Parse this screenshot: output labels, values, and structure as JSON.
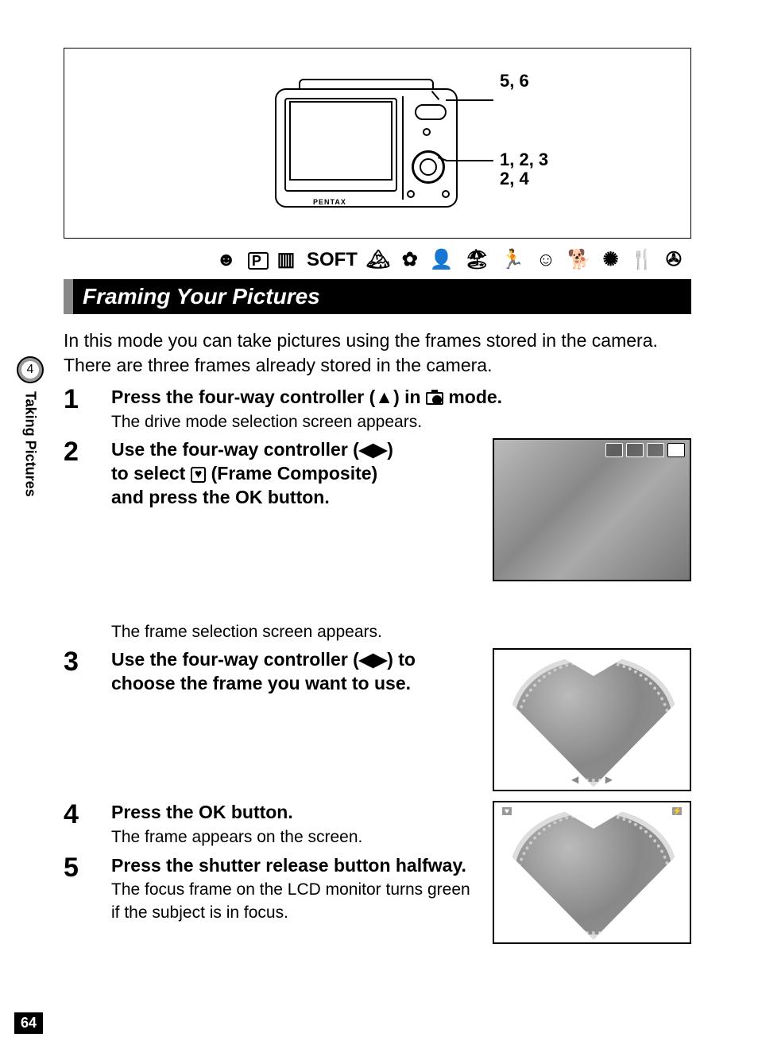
{
  "diagram": {
    "brand": "PENTAX",
    "callout_top": "5, 6",
    "callout_mid_line1": "1, 2, 3",
    "callout_mid_line2": "2, 4"
  },
  "mode_row": {
    "soft_label": "SOFT"
  },
  "section_title": "Framing Your Pictures",
  "intro": "In this mode you can take pictures using the frames stored in the camera. There are three frames already stored in the camera.",
  "steps": {
    "s1": {
      "num": "1",
      "head_pre": "Press the four-way controller (▲) in ",
      "head_post": " mode.",
      "sub": "The drive mode selection screen appears."
    },
    "s2": {
      "num": "2",
      "head_l1": "Use the four-way controller (◀▶)",
      "head_l2a": "to select ",
      "head_l2b": " (Frame Composite)",
      "head_l3a": "and press the ",
      "ok": "OK",
      "head_l3b": " button.",
      "sub": "The frame selection screen appears."
    },
    "s3": {
      "num": "3",
      "head": "Use the four-way controller (◀▶) to choose the frame you want to use."
    },
    "s4": {
      "num": "4",
      "head_a": "Press the ",
      "ok": "OK",
      "head_b": " button.",
      "sub": "The frame appears on the screen."
    },
    "s5": {
      "num": "5",
      "head": "Press the shutter release button halfway.",
      "sub": "The focus frame on the LCD monitor turns green if the subject is in focus."
    }
  },
  "side": {
    "chapter_num": "4",
    "chapter_label": "Taking Pictures"
  },
  "page_number": "64"
}
